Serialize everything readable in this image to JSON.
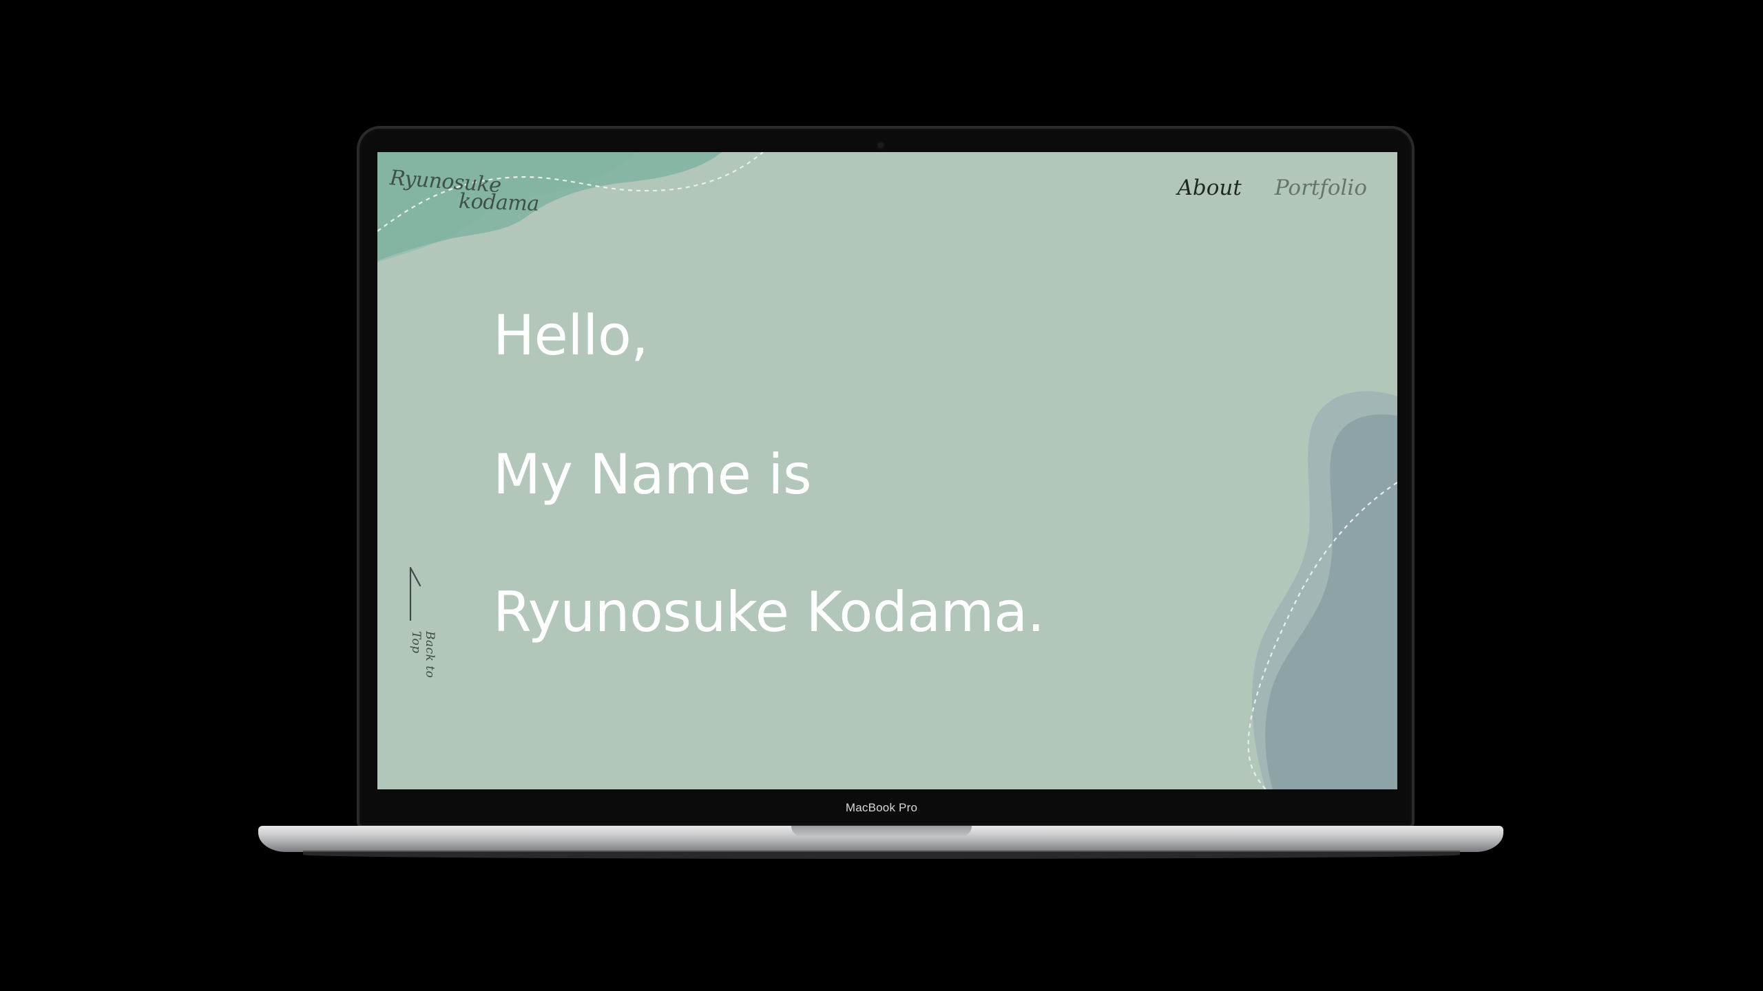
{
  "device": {
    "label": "MacBook Pro"
  },
  "site": {
    "logo_line1": "Ryunosuke",
    "logo_line2": "kodama",
    "nav": [
      {
        "label": "About"
      },
      {
        "label": "Portfolio"
      }
    ],
    "hero": {
      "line1": "Hello,",
      "line2": "My Name is",
      "line3": "Ryunosuke Kodama."
    },
    "back_to_top": "Back to Top"
  },
  "colors": {
    "screen_background": "#b2c7ba",
    "blob_top_left": "#7fb3a0",
    "blob_right": "#8ea3a6",
    "text_hero": "#ffffff",
    "nav_active": "#1f2722",
    "nav_inactive": "#66746c"
  },
  "icons": {
    "back_to_top": "arrow-up-icon"
  }
}
